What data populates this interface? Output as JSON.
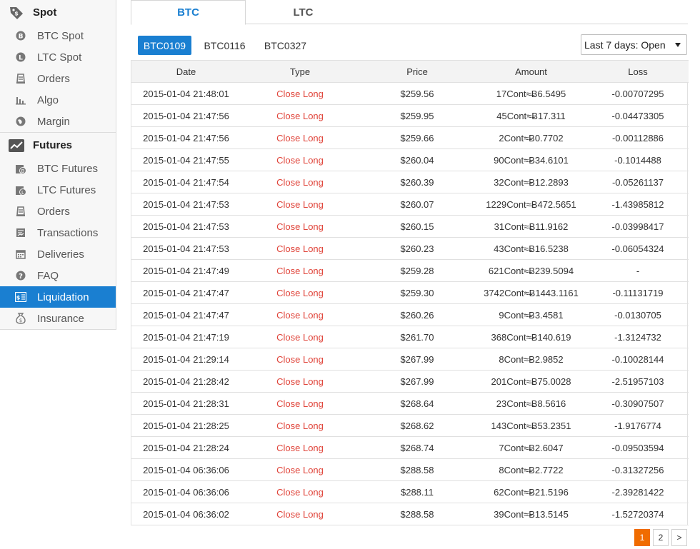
{
  "sidebar": {
    "spot": {
      "title": "Spot",
      "items": [
        {
          "label": "BTC Spot",
          "icon": "btc-coin-icon"
        },
        {
          "label": "LTC Spot",
          "icon": "ltc-coin-icon"
        },
        {
          "label": "Orders",
          "icon": "orders-icon"
        },
        {
          "label": "Algo",
          "icon": "bar-chart-icon"
        },
        {
          "label": "Margin",
          "icon": "globe-icon"
        }
      ]
    },
    "futures": {
      "title": "Futures",
      "items": [
        {
          "label": "BTC Futures",
          "icon": "btc-futures-icon"
        },
        {
          "label": "LTC Futures",
          "icon": "ltc-futures-icon"
        },
        {
          "label": "Orders",
          "icon": "orders-icon"
        },
        {
          "label": "Transactions",
          "icon": "transactions-icon"
        },
        {
          "label": "Deliveries",
          "icon": "calendar-icon"
        },
        {
          "label": "FAQ",
          "icon": "help-icon"
        },
        {
          "label": "Liquidation",
          "icon": "liquidation-icon",
          "active": true
        },
        {
          "label": "Insurance",
          "icon": "money-bag-icon"
        }
      ]
    }
  },
  "tabs": [
    {
      "label": "BTC",
      "active": true
    },
    {
      "label": "LTC",
      "active": false
    }
  ],
  "contracts": [
    {
      "label": "BTC0109",
      "active": true
    },
    {
      "label": "BTC0116",
      "active": false
    },
    {
      "label": "BTC0327",
      "active": false
    }
  ],
  "filter": {
    "selected": "Last 7 days: Open"
  },
  "table": {
    "headers": {
      "date": "Date",
      "type": "Type",
      "price": "Price",
      "amount": "Amount",
      "loss": "Loss"
    },
    "rows": [
      {
        "date": "2015-01-04 21:48:01",
        "type": "Close Long",
        "price": "$259.56",
        "amount": "17Cont≈Ƀ6.5495",
        "loss": "-0.00707295"
      },
      {
        "date": "2015-01-04 21:47:56",
        "type": "Close Long",
        "price": "$259.95",
        "amount": "45Cont≈Ƀ17.311",
        "loss": "-0.04473305"
      },
      {
        "date": "2015-01-04 21:47:56",
        "type": "Close Long",
        "price": "$259.66",
        "amount": "2Cont≈Ƀ0.7702",
        "loss": "-0.00112886"
      },
      {
        "date": "2015-01-04 21:47:55",
        "type": "Close Long",
        "price": "$260.04",
        "amount": "90Cont≈Ƀ34.6101",
        "loss": "-0.1014488"
      },
      {
        "date": "2015-01-04 21:47:54",
        "type": "Close Long",
        "price": "$260.39",
        "amount": "32Cont≈Ƀ12.2893",
        "loss": "-0.05261137"
      },
      {
        "date": "2015-01-04 21:47:53",
        "type": "Close Long",
        "price": "$260.07",
        "amount": "1229Cont≈Ƀ472.5651",
        "loss": "-1.43985812"
      },
      {
        "date": "2015-01-04 21:47:53",
        "type": "Close Long",
        "price": "$260.15",
        "amount": "31Cont≈Ƀ11.9162",
        "loss": "-0.03998417"
      },
      {
        "date": "2015-01-04 21:47:53",
        "type": "Close Long",
        "price": "$260.23",
        "amount": "43Cont≈Ƀ16.5238",
        "loss": "-0.06054324"
      },
      {
        "date": "2015-01-04 21:47:49",
        "type": "Close Long",
        "price": "$259.28",
        "amount": "621Cont≈Ƀ239.5094",
        "loss": "-"
      },
      {
        "date": "2015-01-04 21:47:47",
        "type": "Close Long",
        "price": "$259.30",
        "amount": "3742Cont≈Ƀ1443.1161",
        "loss": "-0.11131719"
      },
      {
        "date": "2015-01-04 21:47:47",
        "type": "Close Long",
        "price": "$260.26",
        "amount": "9Cont≈Ƀ3.4581",
        "loss": "-0.0130705"
      },
      {
        "date": "2015-01-04 21:47:19",
        "type": "Close Long",
        "price": "$261.70",
        "amount": "368Cont≈Ƀ140.619",
        "loss": "-1.3124732"
      },
      {
        "date": "2015-01-04 21:29:14",
        "type": "Close Long",
        "price": "$267.99",
        "amount": "8Cont≈Ƀ2.9852",
        "loss": "-0.10028144"
      },
      {
        "date": "2015-01-04 21:28:42",
        "type": "Close Long",
        "price": "$267.99",
        "amount": "201Cont≈Ƀ75.0028",
        "loss": "-2.51957103"
      },
      {
        "date": "2015-01-04 21:28:31",
        "type": "Close Long",
        "price": "$268.64",
        "amount": "23Cont≈Ƀ8.5616",
        "loss": "-0.30907507"
      },
      {
        "date": "2015-01-04 21:28:25",
        "type": "Close Long",
        "price": "$268.62",
        "amount": "143Cont≈Ƀ53.2351",
        "loss": "-1.9176774"
      },
      {
        "date": "2015-01-04 21:28:24",
        "type": "Close Long",
        "price": "$268.74",
        "amount": "7Cont≈Ƀ2.6047",
        "loss": "-0.09503594"
      },
      {
        "date": "2015-01-04 06:36:06",
        "type": "Close Long",
        "price": "$288.58",
        "amount": "8Cont≈Ƀ2.7722",
        "loss": "-0.31327256"
      },
      {
        "date": "2015-01-04 06:36:06",
        "type": "Close Long",
        "price": "$288.11",
        "amount": "62Cont≈Ƀ21.5196",
        "loss": "-2.39281422"
      },
      {
        "date": "2015-01-04 06:36:02",
        "type": "Close Long",
        "price": "$288.58",
        "amount": "39Cont≈Ƀ13.5145",
        "loss": "-1.52720374"
      }
    ]
  },
  "pagination": {
    "pages": [
      "1",
      "2"
    ],
    "current": "1",
    "next": ">"
  },
  "colors": {
    "accent": "#1a7fd1",
    "close_long": "#e0443a",
    "page_active": "#f06c00"
  }
}
